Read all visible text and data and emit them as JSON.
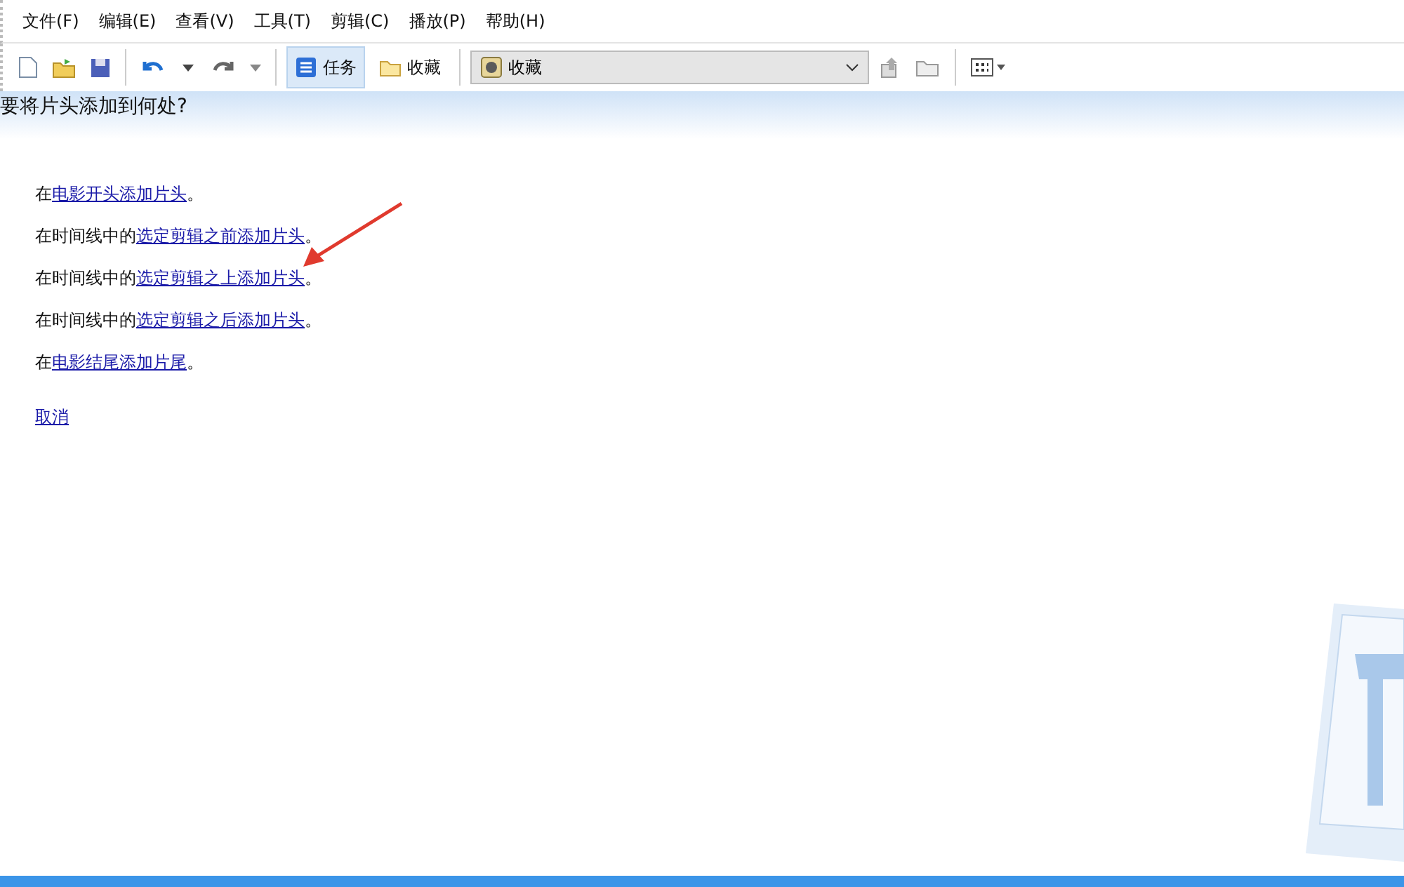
{
  "menu": [
    "文件(F)",
    "编辑(E)",
    "查看(V)",
    "工具(T)",
    "剪辑(C)",
    "播放(P)",
    "帮助(H)"
  ],
  "toolbar": {
    "buttons": [
      {
        "label": "任务",
        "selected": true
      },
      {
        "label": "收藏",
        "selected": false
      }
    ],
    "collection_combo": {
      "value": "收藏"
    }
  },
  "heading": "要将片头添加到何处?",
  "options": [
    {
      "prefix": "在",
      "link": "电影开头添加片头",
      "suffix": "。"
    },
    {
      "prefix": "在时间线中的",
      "link": "选定剪辑之前添加片头",
      "suffix": "。"
    },
    {
      "prefix": "在时间线中的",
      "link": "选定剪辑之上添加片头",
      "suffix": "。"
    },
    {
      "prefix": "在时间线中的",
      "link": "选定剪辑之后添加片头",
      "suffix": "。"
    },
    {
      "prefix": "在",
      "link": "电影结尾添加片尾",
      "suffix": "。"
    }
  ],
  "cancel": "取消"
}
